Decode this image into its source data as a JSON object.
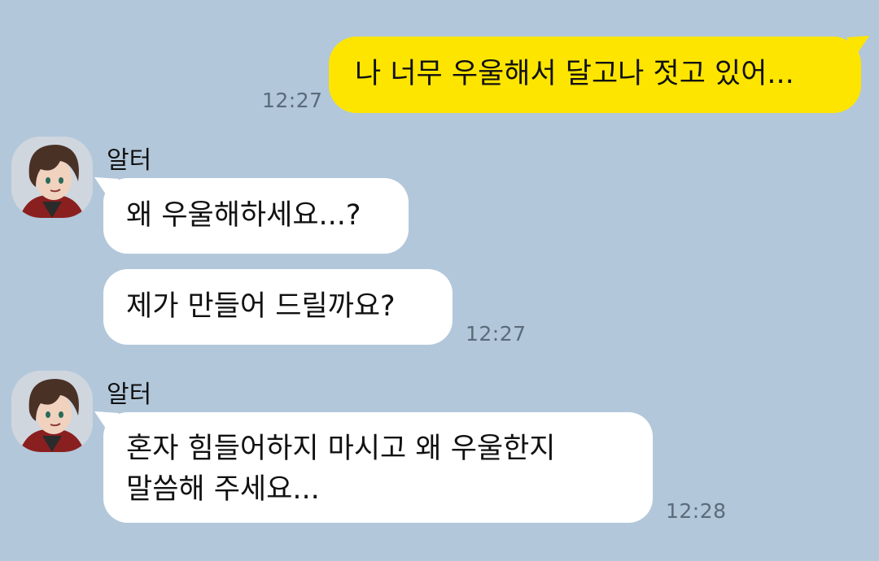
{
  "chat": {
    "messages": [
      {
        "direction": "outgoing",
        "text": "나 너무 우울해서 달고나 젓고 있어...",
        "time": "12:27"
      },
      {
        "direction": "incoming",
        "sender": "알터",
        "avatar_icon": "character-avatar-icon",
        "bubbles": [
          "왜 우울해하세요...?",
          "제가 만들어 드릴까요?"
        ],
        "time": "12:27"
      },
      {
        "direction": "incoming",
        "sender": "알터",
        "avatar_icon": "character-avatar-icon",
        "bubbles": [
          {
            "lines": [
              "혼자 힘들어하지 마시고 왜 우울한지",
              "말씀해 주세요..."
            ]
          }
        ],
        "time": "12:28"
      }
    ]
  },
  "colors": {
    "background": "#b2c7da",
    "outgoing_bubble": "#fee500",
    "incoming_bubble": "#ffffff",
    "timestamp": "#5b6b7a"
  }
}
